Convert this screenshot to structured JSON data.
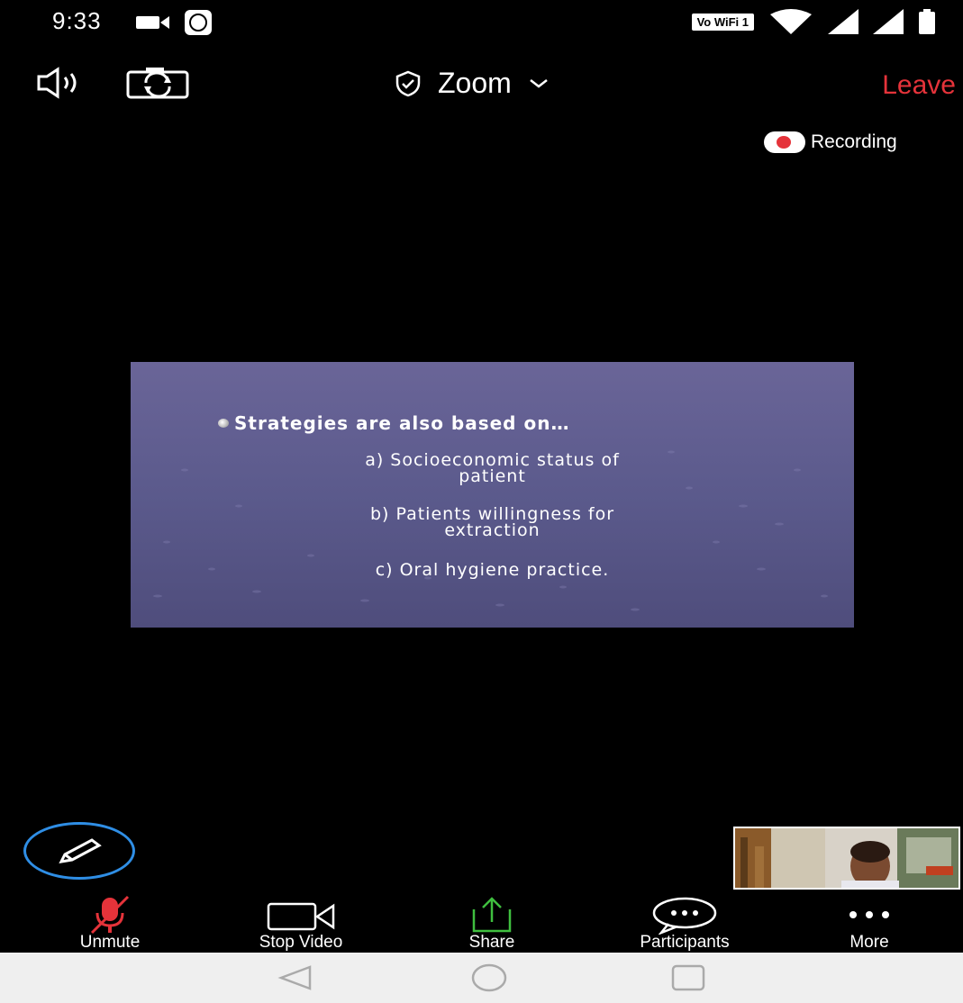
{
  "status_bar": {
    "time": "9:33",
    "network_label": "Vo WiFi 1"
  },
  "toolbar": {
    "title": "Zoom",
    "leave_label": "Leave"
  },
  "recording": {
    "label": "Recording"
  },
  "slide": {
    "heading": "Strategies are also based on…",
    "items": [
      [
        "a) Socioeconomic status of",
        "patient"
      ],
      [
        "b) Patients willingness for",
        "extraction"
      ],
      [
        "c) Oral hygiene practice."
      ]
    ]
  },
  "controls": {
    "unmute": "Unmute",
    "stop_video": "Stop Video",
    "share": "Share",
    "participants": "Participants",
    "more": "More"
  },
  "colors": {
    "accent_red": "#e5333a",
    "share_green": "#3fbf3f",
    "pen_blue": "#2f8ee5"
  }
}
